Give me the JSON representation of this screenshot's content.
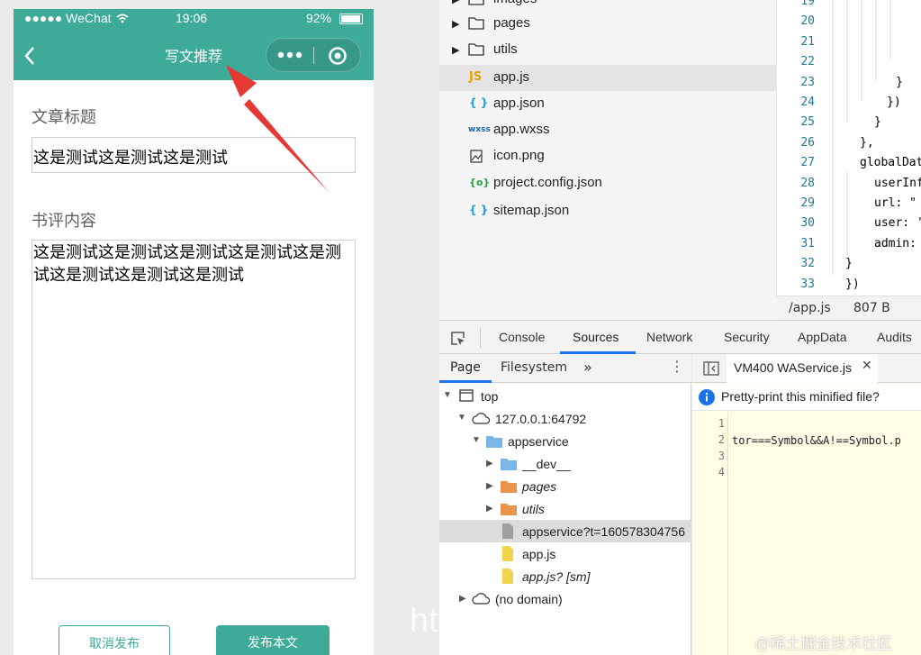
{
  "phone": {
    "status": {
      "signal": "●●●●● WeChat",
      "time": "19:06",
      "battery": "92%"
    },
    "nav": {
      "title": "写文推荐"
    },
    "form": {
      "title_label": "文章标题",
      "title_value": "这是测试这是测试这是测试",
      "content_label": "书评内容",
      "content_value": "这是测试这是测试这是测试这是测试这是测试这是测试这是测试这是测试"
    },
    "buttons": {
      "cancel": "取消发布",
      "publish": "发布本文"
    }
  },
  "file_tree": {
    "items": [
      {
        "name": "images",
        "type": "folder"
      },
      {
        "name": "pages",
        "type": "folder"
      },
      {
        "name": "utils",
        "type": "folder"
      },
      {
        "name": "app.js",
        "type": "js",
        "icon_text": "JS"
      },
      {
        "name": "app.json",
        "type": "json",
        "icon_text": "{ }"
      },
      {
        "name": "app.wxss",
        "type": "wxss",
        "icon_text": "wxss"
      },
      {
        "name": "icon.png",
        "type": "image"
      },
      {
        "name": "project.config.json",
        "type": "config",
        "icon_text": "{o}"
      },
      {
        "name": "sitemap.json",
        "type": "json",
        "icon_text": "{ }"
      }
    ]
  },
  "code": {
    "line_numbers": [
      "19",
      "20",
      "21",
      "22",
      "23",
      "24",
      "25",
      "26",
      "27",
      "28",
      "29",
      "30",
      "31",
      "32",
      "33"
    ],
    "lines": [
      "",
      "",
      "",
      "",
      "}",
      "})",
      "}",
      "},",
      "globalDat",
      "userInf",
      "url: \"",
      "user: '",
      "admin:",
      "}",
      "})"
    ],
    "status_file": "/app.js",
    "status_size": "807 B"
  },
  "devtools": {
    "tabs": [
      "Console",
      "Sources",
      "Network",
      "Security",
      "AppData",
      "Audits"
    ],
    "active_tab": "Sources",
    "left_tabs": [
      "Page",
      "Filesystem",
      "»"
    ],
    "tree": [
      {
        "label": "top",
        "depth": 0,
        "icon": "frame"
      },
      {
        "label": "127.0.0.1:64792",
        "depth": 1,
        "icon": "cloud"
      },
      {
        "label": "appservice",
        "depth": 2,
        "icon": "folder-blue"
      },
      {
        "label": "__dev__",
        "depth": 3,
        "icon": "folder-blue"
      },
      {
        "label": "pages",
        "depth": 3,
        "icon": "folder-orange"
      },
      {
        "label": "utils",
        "depth": 3,
        "icon": "folder-orange"
      },
      {
        "label": "appservice?t=160578304756",
        "depth": 3,
        "icon": "file-gray"
      },
      {
        "label": "app.js",
        "depth": 3,
        "icon": "file-yellow"
      },
      {
        "label": "app.js? [sm]",
        "depth": 3,
        "icon": "file-yellow"
      },
      {
        "label": "(no domain)",
        "depth": 1,
        "icon": "cloud"
      }
    ],
    "editor_tab": "VM400 WAService.js",
    "pretty_print": "Pretty-print this minified file?",
    "editor_line_numbers": [
      "1",
      "2",
      "3",
      "4"
    ],
    "editor_code_line2": "tor===Symbol&&A!==Symbol.p"
  },
  "watermarks": {
    "url": "https://blog.csdn.n",
    "brand": "@稀土掘金技术社区"
  }
}
